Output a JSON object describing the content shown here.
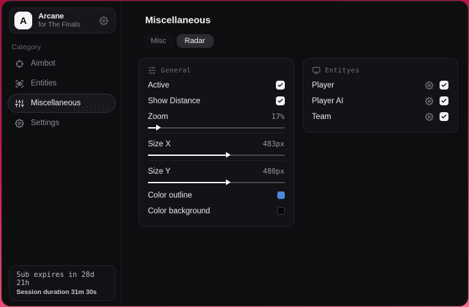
{
  "colors": {
    "accent_red": "#d6174e",
    "outline_blue": "#4e86dd",
    "background_black": "#050505"
  },
  "sidebar": {
    "logo": {
      "initial": "A",
      "title": "Arcane",
      "subtitle": "for The Finals",
      "icon": "gear-icon"
    },
    "category_label": "Category",
    "items": [
      {
        "label": "Aimbot",
        "icon": "crosshair-icon",
        "active": false
      },
      {
        "label": "Entities",
        "icon": "scan-eye-icon",
        "active": false
      },
      {
        "label": "Miscellaneous",
        "icon": "sliders-vertical-icon",
        "active": true
      },
      {
        "label": "Settings",
        "icon": "gear-icon",
        "active": false
      }
    ],
    "subscription": {
      "line1": "Sub expires in 28d 21h",
      "line2": "Session duration 31m 30s"
    }
  },
  "main": {
    "title": "Miscellaneous",
    "tabs": [
      {
        "label": "Misc",
        "active": false
      },
      {
        "label": "Radar",
        "active": true
      }
    ],
    "general_card": {
      "header": "General",
      "header_icon": "sliders-horizontal-icon",
      "active": {
        "label": "Active",
        "checked": true
      },
      "show_distance": {
        "label": "Show Distance",
        "checked": true
      },
      "zoom": {
        "label": "Zoom",
        "value": "17%",
        "fill_percent": 6
      },
      "size_x": {
        "label": "Size X",
        "value": "483px",
        "fill_percent": 57
      },
      "size_y": {
        "label": "Size Y",
        "value": "480px",
        "fill_percent": 57
      },
      "color_outline": {
        "label": "Color outline",
        "color": "#4e86dd"
      },
      "color_background": {
        "label": "Color background",
        "color": "#050505"
      }
    },
    "entities_card": {
      "header": "Entityes",
      "header_icon": "monitor-icon",
      "rows": [
        {
          "label": "Player",
          "checked": true
        },
        {
          "label": "Player AI",
          "checked": true
        },
        {
          "label": "Team",
          "checked": true
        }
      ]
    }
  }
}
